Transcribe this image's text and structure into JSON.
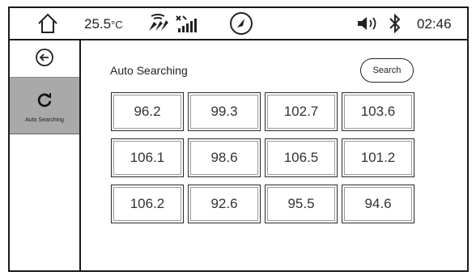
{
  "status_bar": {
    "temperature": "25.5",
    "temperature_unit": "°C",
    "time": "02:46",
    "icons": [
      "home-icon",
      "fan-icon",
      "signal-icon",
      "navigation-icon",
      "volume-icon",
      "bluetooth-icon"
    ]
  },
  "sidebar": {
    "back_icon": "back-arrow-icon",
    "active_item": {
      "icon": "refresh-icon",
      "label": "Auto Searching"
    }
  },
  "main": {
    "title": "Auto Searching",
    "search_button": "Search",
    "stations": [
      "96.2",
      "99.3",
      "102.7",
      "103.6",
      "106.1",
      "98.6",
      "106.5",
      "101.2",
      "106.2",
      "92.6",
      "95.5",
      "94.6"
    ]
  }
}
